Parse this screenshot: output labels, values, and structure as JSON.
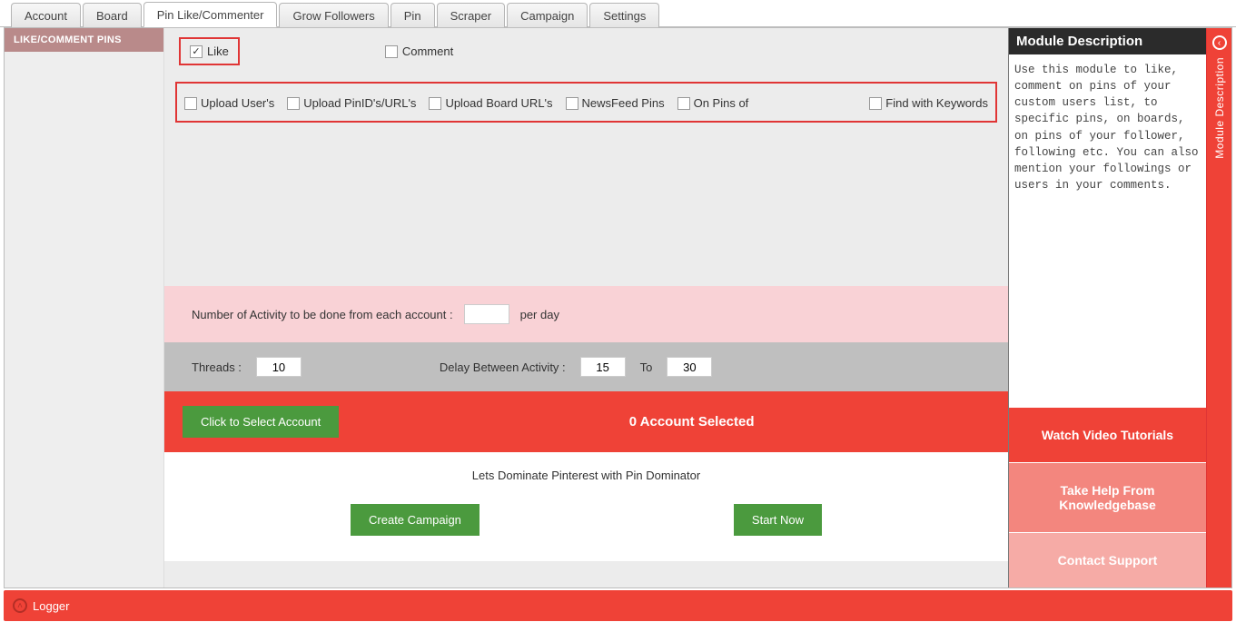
{
  "tabs": {
    "t0": "Account",
    "t1": "Board",
    "t2": "Pin Like/Commenter",
    "t3": "Grow Followers",
    "t4": "Pin",
    "t5": "Scraper",
    "t6": "Campaign",
    "t7": "Settings"
  },
  "leftnav": {
    "item1": "LIKE/COMMENT PINS"
  },
  "modes": {
    "like": "Like",
    "comment": "Comment"
  },
  "opts": {
    "upload_users": "Upload User's",
    "upload_pinids": "Upload PinID's/URL's",
    "upload_board": "Upload Board URL's",
    "newsfeed": "NewsFeed Pins",
    "onpinsof": "On Pins of",
    "findkw": "Find with Keywords"
  },
  "activity": {
    "label": "Number of Activity to be done from each account :",
    "value": "",
    "perday": "per day"
  },
  "threads": {
    "label": "Threads :",
    "value": "10",
    "delay_label": "Delay Between Activity :",
    "delay_from": "15",
    "to": "To",
    "delay_to": "30"
  },
  "account_bar": {
    "select_btn": "Click to Select Account",
    "status": "0 Account Selected"
  },
  "bottom": {
    "tagline": "Lets Dominate Pinterest with Pin Dominator",
    "create": "Create Campaign",
    "start": "Start Now"
  },
  "right": {
    "header": "Module Description",
    "body": "Use this module to like, comment on pins of your custom users list, to specific pins, on boards, on pins of your follower, following etc. You can also mention your followings or users in your comments.",
    "btn1": "Watch Video Tutorials",
    "btn2": "Take Help From Knowledgebase",
    "btn3": "Contact Support",
    "strip": "Module Description"
  },
  "logger": {
    "label": "Logger"
  }
}
